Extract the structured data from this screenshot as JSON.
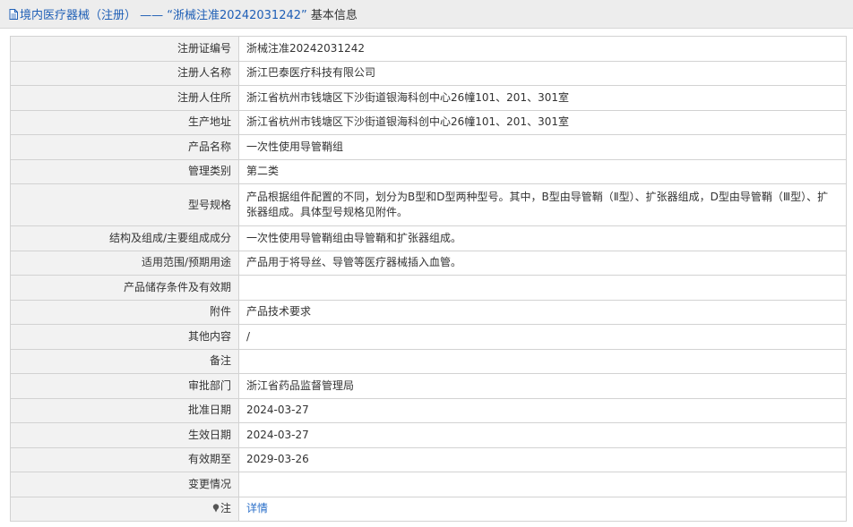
{
  "header": {
    "category": "境内医疗器械（注册）",
    "separator": "——",
    "record_title": "“浙械注准20242031242”",
    "suffix": "基本信息",
    "icon": "document-icon"
  },
  "rows": [
    {
      "label": "注册证编号",
      "value": "浙械注准20242031242"
    },
    {
      "label": "注册人名称",
      "value": "浙江巴泰医疗科技有限公司"
    },
    {
      "label": "注册人住所",
      "value": "浙江省杭州市钱塘区下沙街道银海科创中心26幢101、201、301室"
    },
    {
      "label": "生产地址",
      "value": "浙江省杭州市钱塘区下沙街道银海科创中心26幢101、201、301室"
    },
    {
      "label": "产品名称",
      "value": "一次性使用导管鞘组"
    },
    {
      "label": "管理类别",
      "value": "第二类"
    },
    {
      "label": "型号规格",
      "value": "产品根据组件配置的不同，划分为B型和D型两种型号。其中，B型由导管鞘（Ⅱ型）、扩张器组成，D型由导管鞘（Ⅲ型）、扩张器组成。具体型号规格见附件。"
    },
    {
      "label": "结构及组成/主要组成成分",
      "value": "一次性使用导管鞘组由导管鞘和扩张器组成。"
    },
    {
      "label": "适用范围/预期用途",
      "value": "产品用于将导丝、导管等医疗器械插入血管。"
    },
    {
      "label": "产品储存条件及有效期",
      "value": ""
    },
    {
      "label": "附件",
      "value": "产品技术要求"
    },
    {
      "label": "其他内容",
      "value": "/"
    },
    {
      "label": "备注",
      "value": ""
    },
    {
      "label": "审批部门",
      "value": "浙江省药品监督管理局"
    },
    {
      "label": "批准日期",
      "value": "2024-03-27"
    },
    {
      "label": "生效日期",
      "value": "2024-03-27"
    },
    {
      "label": "有效期至",
      "value": "2029-03-26"
    },
    {
      "label": "变更情况",
      "value": ""
    }
  ],
  "note_row": {
    "label": "注",
    "icon": "pin-icon",
    "link_text": "详情"
  },
  "colors": {
    "header_bg": "#ededed",
    "title_blue": "#1f5fb6",
    "label_bg": "#f2f2f2",
    "border": "#d2d2d2",
    "link": "#2a6fc9"
  }
}
